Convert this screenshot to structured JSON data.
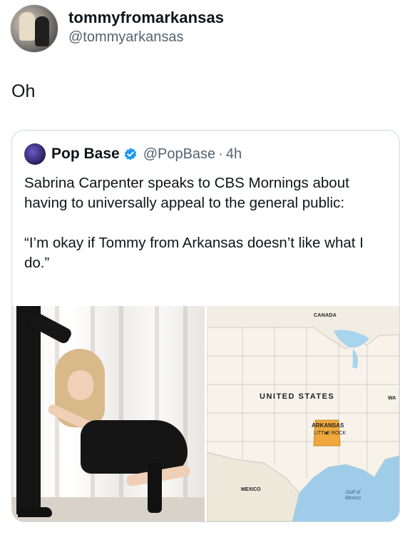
{
  "post": {
    "display_name": "tommyfromarkansas",
    "handle": "@tommyarkansas",
    "text": "Oh"
  },
  "quote": {
    "display_name": "Pop Base",
    "handle": "@PopBase",
    "separator": "·",
    "time": "4h",
    "verified": true,
    "paragraphs": [
      "Sabrina Carpenter speaks to CBS Mornings about having to universally appeal to the general public:",
      "“I’m okay if Tommy from Arkansas doesn’t like what I do.”"
    ],
    "media": {
      "photo_icon": "photo-of-woman-icon",
      "map": {
        "canada": "CANADA",
        "united_states": "UNITED STATES",
        "arkansas": "ARKANSAS",
        "little_rock": "LITTLE ROCK",
        "mexico": "MEXICO",
        "gulf_of_mexico": "Gulf of Mexico",
        "wa": "WA",
        "highlight_color": "#f0a83c"
      }
    }
  },
  "colors": {
    "text_primary": "#0f1419",
    "text_secondary": "#536471",
    "verified_blue": "#1d9bf0",
    "card_border": "#cfd9de"
  }
}
